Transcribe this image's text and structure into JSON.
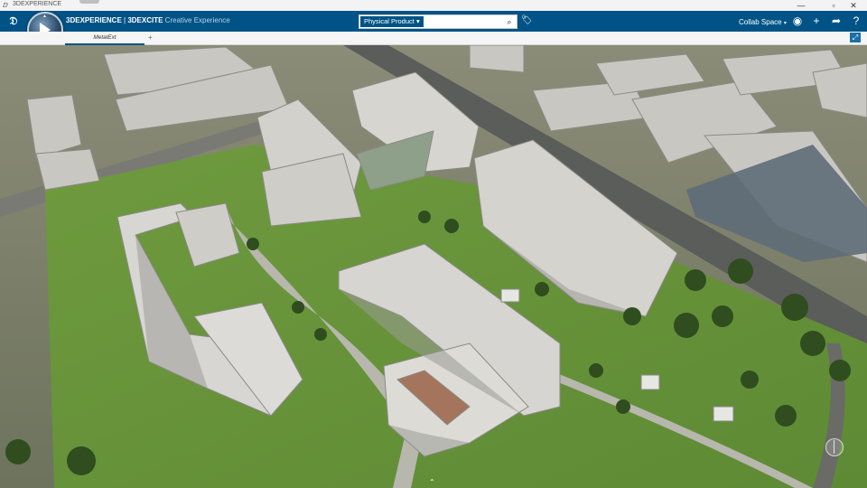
{
  "window": {
    "title": "3DEXPERIENCE",
    "controls": [
      "minimize",
      "maximize",
      "close"
    ]
  },
  "toolbar": {
    "brand_primary": "3DEXPERIENCE",
    "brand_separator": " | ",
    "brand_app": "3DEXCITE",
    "brand_sub": " Creative Experience",
    "search_category": "Physical Product",
    "search_placeholder": "",
    "collab_space": "Collab Space",
    "icons": [
      "ds-logo",
      "compass",
      "search-icon",
      "tag-icon",
      "user-icon",
      "add-icon",
      "share-icon",
      "help-icon"
    ]
  },
  "tabs": {
    "items": [
      {
        "label": "MetalExt"
      }
    ],
    "add_label": "+"
  },
  "viewport": {
    "description_icons": [
      "nav-compass-icon",
      "expand-icon",
      "chevron-up-icon"
    ]
  },
  "colors": {
    "toolbar_bg": "#005386",
    "accent": "#005386"
  }
}
